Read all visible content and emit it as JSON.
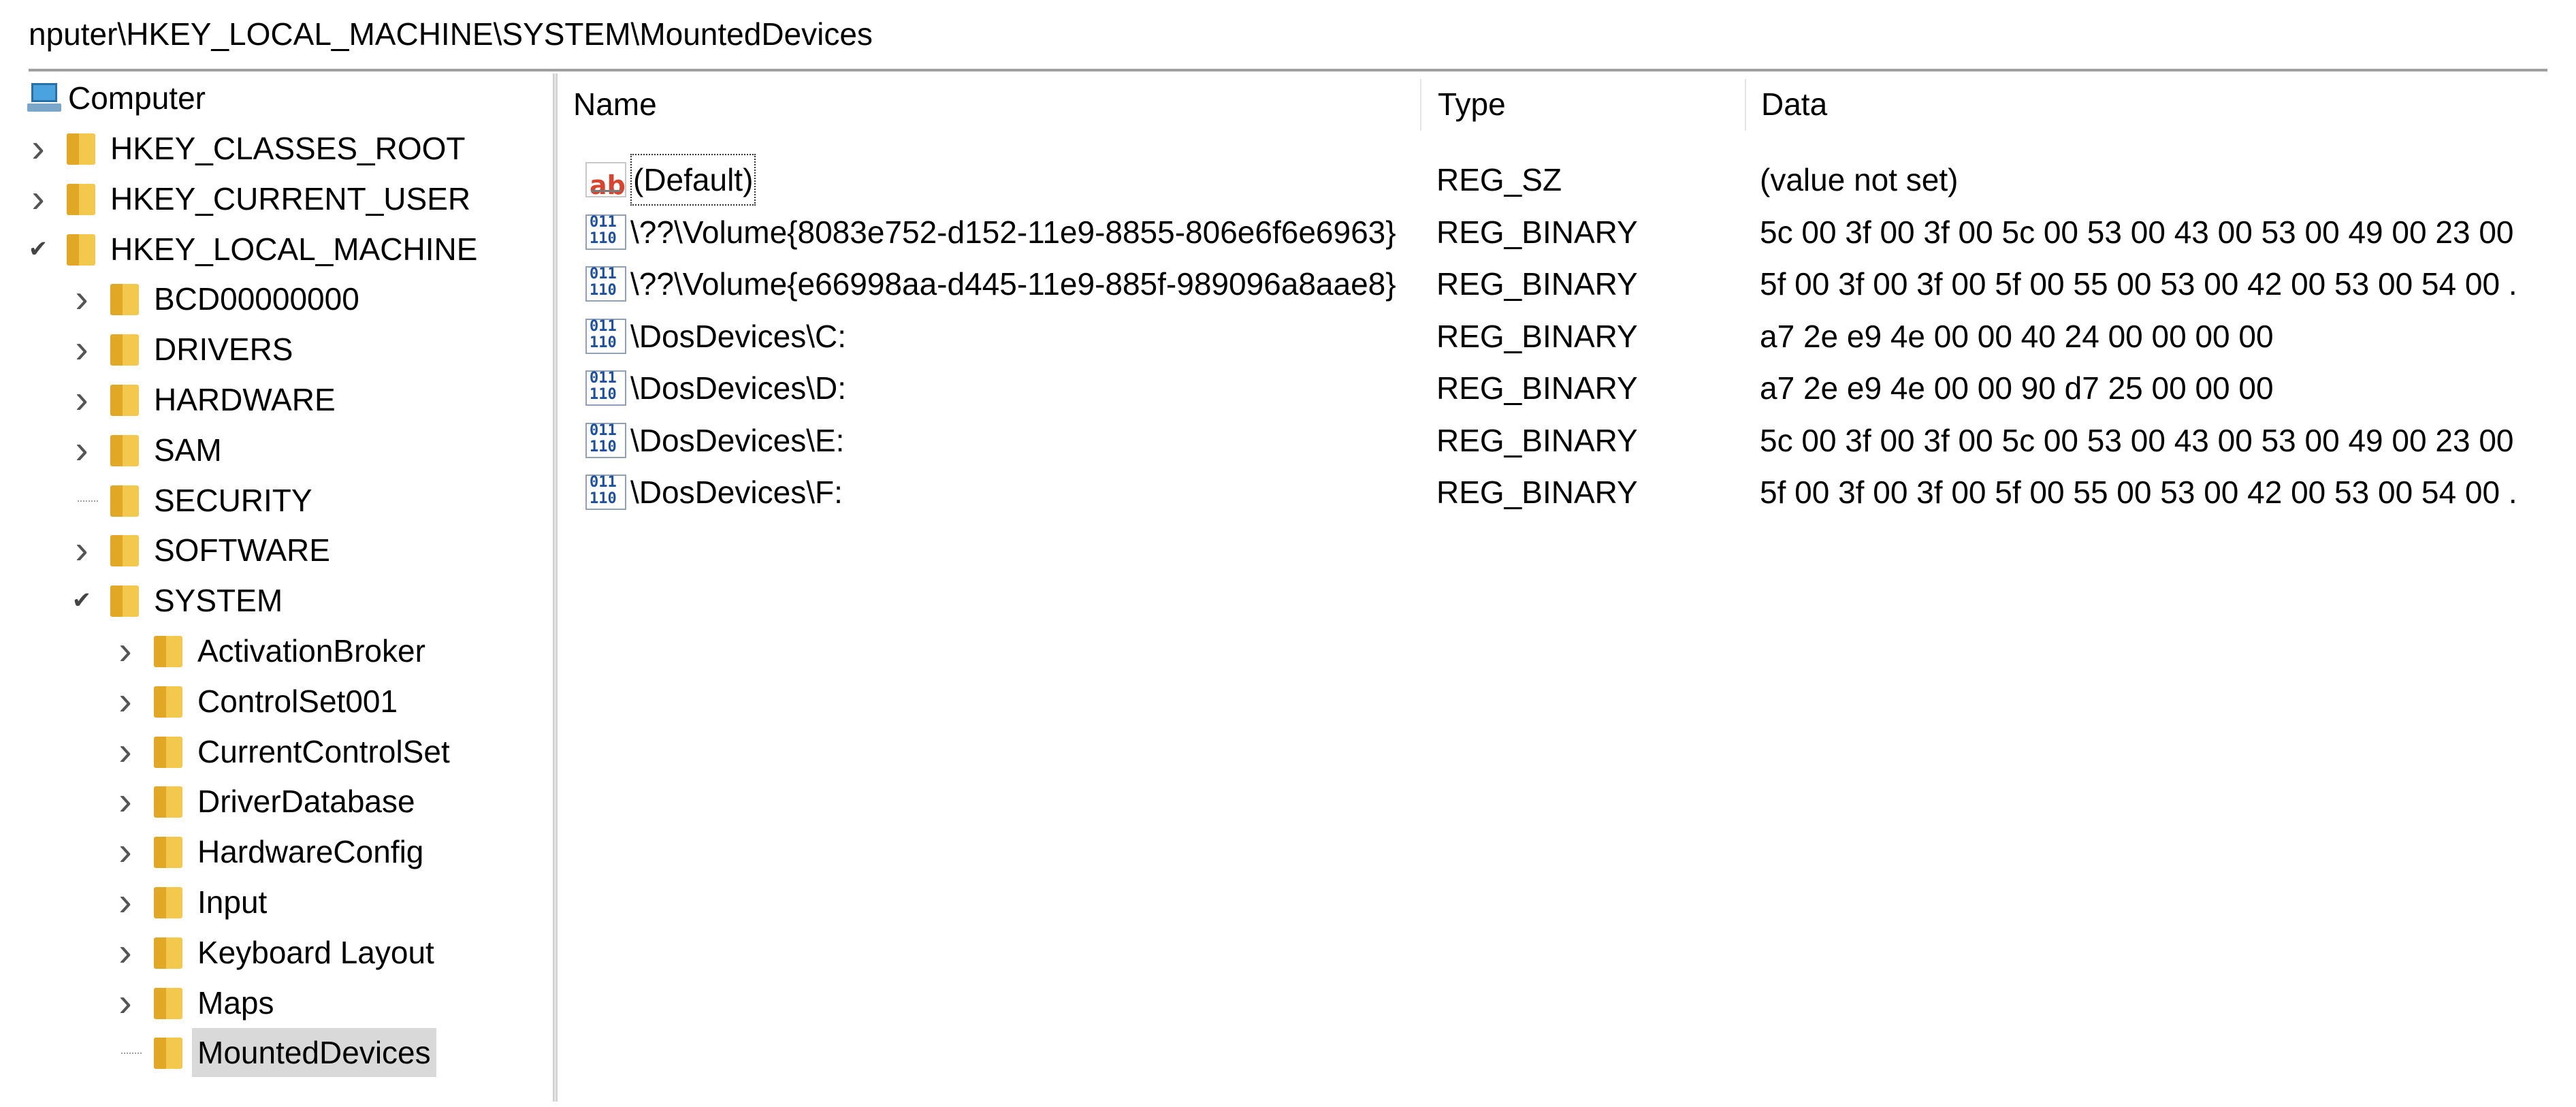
{
  "address_bar": {
    "path": "nputer\\HKEY_LOCAL_MACHINE\\SYSTEM\\MountedDevices"
  },
  "tree": {
    "root": "Computer",
    "nodes": [
      {
        "label": "HKEY_CLASSES_ROOT",
        "expander": ">"
      },
      {
        "label": "HKEY_CURRENT_USER",
        "expander": ">"
      },
      {
        "label": "HKEY_LOCAL_MACHINE",
        "expander": "v"
      },
      {
        "label": "BCD00000000",
        "expander": ">"
      },
      {
        "label": "DRIVERS",
        "expander": ">"
      },
      {
        "label": "HARDWARE",
        "expander": ">"
      },
      {
        "label": "SAM",
        "expander": ">"
      },
      {
        "label": "SECURITY",
        "expander": ""
      },
      {
        "label": "SOFTWARE",
        "expander": ">"
      },
      {
        "label": "SYSTEM",
        "expander": "v"
      },
      {
        "label": "ActivationBroker",
        "expander": ">"
      },
      {
        "label": "ControlSet001",
        "expander": ">"
      },
      {
        "label": "CurrentControlSet",
        "expander": ">"
      },
      {
        "label": "DriverDatabase",
        "expander": ">"
      },
      {
        "label": "HardwareConfig",
        "expander": ">"
      },
      {
        "label": "Input",
        "expander": ">"
      },
      {
        "label": "Keyboard Layout",
        "expander": ">"
      },
      {
        "label": "Maps",
        "expander": ">"
      },
      {
        "label": "MountedDevices",
        "expander": "",
        "selected": true
      }
    ]
  },
  "list": {
    "columns": {
      "name": "Name",
      "type": "Type",
      "data": "Data"
    },
    "rows": [
      {
        "name": "(Default)",
        "type": "REG_SZ",
        "data": "(value not set)",
        "icon": "string-value-icon"
      },
      {
        "name": "\\??\\Volume{8083e752-d152-11e9-8855-806e6f6e6963}",
        "type": "REG_BINARY",
        "data": "5c 00 3f 00 3f 00 5c 00 53 00 43 00 53 00 49 00 23 00",
        "icon": "binary-value-icon"
      },
      {
        "name": "\\??\\Volume{e66998aa-d445-11e9-885f-989096a8aae8}",
        "type": "REG_BINARY",
        "data": "5f 00 3f 00 3f 00 5f 00 55 00 53 00 42 00 53 00 54 00 .",
        "icon": "binary-value-icon"
      },
      {
        "name": "\\DosDevices\\C:",
        "type": "REG_BINARY",
        "data": "a7 2e e9 4e 00 00 40 24 00 00 00 00",
        "icon": "binary-value-icon"
      },
      {
        "name": "\\DosDevices\\D:",
        "type": "REG_BINARY",
        "data": "a7 2e e9 4e 00 00 90 d7 25 00 00 00",
        "icon": "binary-value-icon"
      },
      {
        "name": "\\DosDevices\\E:",
        "type": "REG_BINARY",
        "data": "5c 00 3f 00 3f 00 5c 00 53 00 43 00 53 00 49 00 23 00",
        "icon": "binary-value-icon"
      },
      {
        "name": "\\DosDevices\\F:",
        "type": "REG_BINARY",
        "data": "5f 00 3f 00 3f 00 5f 00 55 00 53 00 42 00 53 00 54 00 .",
        "icon": "binary-value-icon"
      }
    ]
  },
  "colors": {
    "selection": "#d9d9d9",
    "folder": "#f2c94c",
    "string_icon_text": "#d9442f",
    "binary_icon_text": "#1d4fa3"
  }
}
